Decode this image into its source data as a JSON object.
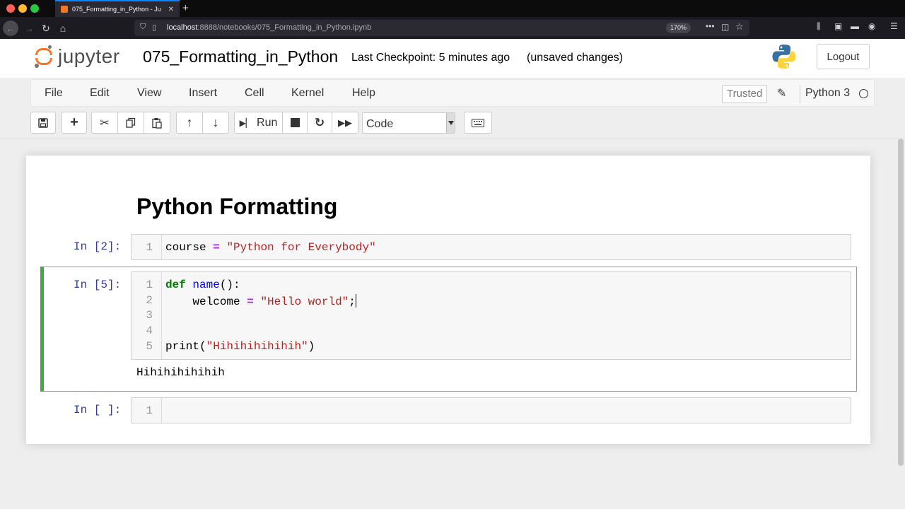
{
  "browser": {
    "tab_title": "075_Formatting_in_Python - Ju",
    "url_host": "localhost",
    "url_rest": ":8888/notebooks/075_Formatting_in_Python.ipynb",
    "zoom": "170%"
  },
  "header": {
    "logo_text": "jupyter",
    "notebook_title": "075_Formatting_in_Python",
    "checkpoint": "Last Checkpoint: 5 minutes ago",
    "save_status": "(unsaved changes)",
    "logout_label": "Logout"
  },
  "menu": {
    "items": [
      "File",
      "Edit",
      "View",
      "Insert",
      "Cell",
      "Kernel",
      "Help"
    ],
    "trusted": "Trusted",
    "kernel_name": "Python 3"
  },
  "toolbar": {
    "run_label": "Run",
    "cell_type": "Code"
  },
  "notebook": {
    "heading": "Python Formatting",
    "cells": [
      {
        "prompt": "In [2]:",
        "line_numbers": [
          "1"
        ],
        "line1": {
          "var": "course",
          "op": "=",
          "str": "\"Python for Everybody\""
        }
      },
      {
        "prompt": "In [5]:",
        "line_numbers": [
          "1",
          "2",
          "3",
          "4",
          "5"
        ],
        "line1": {
          "kw": "def",
          "fn": "name",
          "rest": "():"
        },
        "line2": {
          "indent": "    ",
          "var": "welcome",
          "op": "=",
          "str": "\"Hello world\"",
          "rest": ";"
        },
        "line5": {
          "fn": "print",
          "open": "(",
          "str": "\"Hihihihihihih\"",
          "close": ")"
        },
        "output": "Hihihihihihih"
      },
      {
        "prompt": "In [ ]:",
        "line_numbers": [
          "1"
        ]
      }
    ]
  },
  "colors": {
    "selected_border": "#42a842",
    "prompt": "#303f9f",
    "jupyter_orange": "#f37726"
  }
}
